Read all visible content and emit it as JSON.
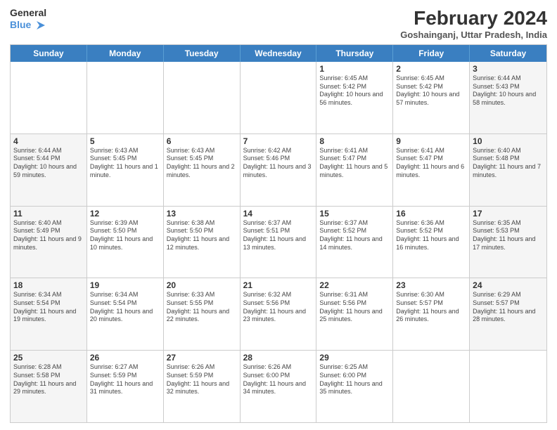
{
  "header": {
    "logo_line1": "General",
    "logo_line2": "Blue",
    "month_year": "February 2024",
    "location": "Goshainganj, Uttar Pradesh, India"
  },
  "days_of_week": [
    "Sunday",
    "Monday",
    "Tuesday",
    "Wednesday",
    "Thursday",
    "Friday",
    "Saturday"
  ],
  "weeks": [
    [
      {
        "day": "",
        "info": ""
      },
      {
        "day": "",
        "info": ""
      },
      {
        "day": "",
        "info": ""
      },
      {
        "day": "",
        "info": ""
      },
      {
        "day": "1",
        "info": "Sunrise: 6:45 AM\nSunset: 5:42 PM\nDaylight: 10 hours and 56 minutes."
      },
      {
        "day": "2",
        "info": "Sunrise: 6:45 AM\nSunset: 5:42 PM\nDaylight: 10 hours and 57 minutes."
      },
      {
        "day": "3",
        "info": "Sunrise: 6:44 AM\nSunset: 5:43 PM\nDaylight: 10 hours and 58 minutes."
      }
    ],
    [
      {
        "day": "4",
        "info": "Sunrise: 6:44 AM\nSunset: 5:44 PM\nDaylight: 10 hours and 59 minutes."
      },
      {
        "day": "5",
        "info": "Sunrise: 6:43 AM\nSunset: 5:45 PM\nDaylight: 11 hours and 1 minute."
      },
      {
        "day": "6",
        "info": "Sunrise: 6:43 AM\nSunset: 5:45 PM\nDaylight: 11 hours and 2 minutes."
      },
      {
        "day": "7",
        "info": "Sunrise: 6:42 AM\nSunset: 5:46 PM\nDaylight: 11 hours and 3 minutes."
      },
      {
        "day": "8",
        "info": "Sunrise: 6:41 AM\nSunset: 5:47 PM\nDaylight: 11 hours and 5 minutes."
      },
      {
        "day": "9",
        "info": "Sunrise: 6:41 AM\nSunset: 5:47 PM\nDaylight: 11 hours and 6 minutes."
      },
      {
        "day": "10",
        "info": "Sunrise: 6:40 AM\nSunset: 5:48 PM\nDaylight: 11 hours and 7 minutes."
      }
    ],
    [
      {
        "day": "11",
        "info": "Sunrise: 6:40 AM\nSunset: 5:49 PM\nDaylight: 11 hours and 9 minutes."
      },
      {
        "day": "12",
        "info": "Sunrise: 6:39 AM\nSunset: 5:50 PM\nDaylight: 11 hours and 10 minutes."
      },
      {
        "day": "13",
        "info": "Sunrise: 6:38 AM\nSunset: 5:50 PM\nDaylight: 11 hours and 12 minutes."
      },
      {
        "day": "14",
        "info": "Sunrise: 6:37 AM\nSunset: 5:51 PM\nDaylight: 11 hours and 13 minutes."
      },
      {
        "day": "15",
        "info": "Sunrise: 6:37 AM\nSunset: 5:52 PM\nDaylight: 11 hours and 14 minutes."
      },
      {
        "day": "16",
        "info": "Sunrise: 6:36 AM\nSunset: 5:52 PM\nDaylight: 11 hours and 16 minutes."
      },
      {
        "day": "17",
        "info": "Sunrise: 6:35 AM\nSunset: 5:53 PM\nDaylight: 11 hours and 17 minutes."
      }
    ],
    [
      {
        "day": "18",
        "info": "Sunrise: 6:34 AM\nSunset: 5:54 PM\nDaylight: 11 hours and 19 minutes."
      },
      {
        "day": "19",
        "info": "Sunrise: 6:34 AM\nSunset: 5:54 PM\nDaylight: 11 hours and 20 minutes."
      },
      {
        "day": "20",
        "info": "Sunrise: 6:33 AM\nSunset: 5:55 PM\nDaylight: 11 hours and 22 minutes."
      },
      {
        "day": "21",
        "info": "Sunrise: 6:32 AM\nSunset: 5:56 PM\nDaylight: 11 hours and 23 minutes."
      },
      {
        "day": "22",
        "info": "Sunrise: 6:31 AM\nSunset: 5:56 PM\nDaylight: 11 hours and 25 minutes."
      },
      {
        "day": "23",
        "info": "Sunrise: 6:30 AM\nSunset: 5:57 PM\nDaylight: 11 hours and 26 minutes."
      },
      {
        "day": "24",
        "info": "Sunrise: 6:29 AM\nSunset: 5:57 PM\nDaylight: 11 hours and 28 minutes."
      }
    ],
    [
      {
        "day": "25",
        "info": "Sunrise: 6:28 AM\nSunset: 5:58 PM\nDaylight: 11 hours and 29 minutes."
      },
      {
        "day": "26",
        "info": "Sunrise: 6:27 AM\nSunset: 5:59 PM\nDaylight: 11 hours and 31 minutes."
      },
      {
        "day": "27",
        "info": "Sunrise: 6:26 AM\nSunset: 5:59 PM\nDaylight: 11 hours and 32 minutes."
      },
      {
        "day": "28",
        "info": "Sunrise: 6:26 AM\nSunset: 6:00 PM\nDaylight: 11 hours and 34 minutes."
      },
      {
        "day": "29",
        "info": "Sunrise: 6:25 AM\nSunset: 6:00 PM\nDaylight: 11 hours and 35 minutes."
      },
      {
        "day": "",
        "info": ""
      },
      {
        "day": "",
        "info": ""
      }
    ]
  ]
}
